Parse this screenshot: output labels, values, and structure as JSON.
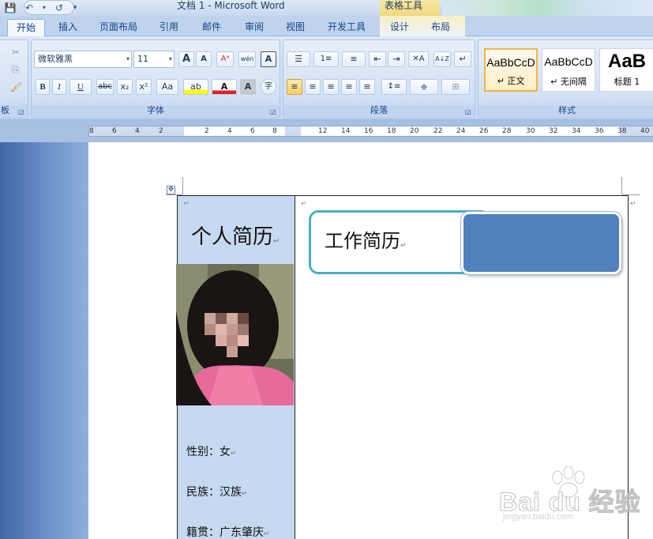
{
  "titlebar": {
    "title": "文档 1 - Microsoft Word",
    "context_tools": "表格工具",
    "qat": {
      "save": "💾",
      "undo": "↶",
      "undo_dd": "▾",
      "redo": "↺",
      "customize": "▾"
    }
  },
  "tabs": [
    {
      "label": "开始",
      "active": true
    },
    {
      "label": "插入"
    },
    {
      "label": "页面布局"
    },
    {
      "label": "引用"
    },
    {
      "label": "邮件"
    },
    {
      "label": "审阅"
    },
    {
      "label": "视图"
    },
    {
      "label": "开发工具"
    },
    {
      "label": "设计",
      "context": true
    },
    {
      "label": "布局",
      "context": true
    }
  ],
  "ribbon": {
    "clipboard": {
      "label": "板",
      "cut": "✂",
      "copy": "⎘",
      "painter": "🖌"
    },
    "font": {
      "label": "字体",
      "name": "微软雅黑",
      "size": "11",
      "grow": "A",
      "shrink": "A",
      "clear": "Aᵃ",
      "phonetic": "wén",
      "border": "A",
      "bold": "B",
      "italic": "I",
      "underline": "U",
      "strike": "abc",
      "sub": "x₂",
      "sup": "x²",
      "case": "Aa",
      "highlight": "ab",
      "color": "A",
      "shade": "A",
      "enclose": "字"
    },
    "paragraph": {
      "label": "段落",
      "bullets": "☰",
      "numbering": "1≡",
      "multilevel": "≡",
      "dec_indent": "⇤",
      "inc_indent": "⇥",
      "chinese_layout": "✕A",
      "sort": "A↓Z",
      "show_marks": "↵",
      "align_left": "≡",
      "center": "≡",
      "align_right": "≡",
      "justify": "≡",
      "distribute": "≡",
      "line_spacing": "↕≡",
      "shading": "◆",
      "borders": "⊞"
    },
    "styles": {
      "label": "样式",
      "items": [
        {
          "sample": "AaBbCcD",
          "name": "↵ 正文",
          "selected": true
        },
        {
          "sample": "AaBbCcD",
          "name": "↵ 无间隔"
        },
        {
          "sample": "AaB",
          "name": "标题 1"
        }
      ]
    }
  },
  "ruler": {
    "labels": [
      "8",
      "6",
      "4",
      "2",
      "2",
      "4",
      "6",
      "8",
      "12",
      "14",
      "16",
      "18",
      "20",
      "22",
      "24",
      "26",
      "28",
      "30",
      "32",
      "34",
      "36",
      "38",
      "40"
    ]
  },
  "document": {
    "resume_title": "个人简历",
    "work_title": "工作简历",
    "para_mark": "↵",
    "info": [
      {
        "label": "性别：女"
      },
      {
        "label": "民族：汉族"
      },
      {
        "label": "籍贯：广东肇庆"
      }
    ]
  },
  "watermark": {
    "text": "Bai du 经验",
    "sub": "jingyan.baidu.com"
  },
  "colors": {
    "left_cell": "#c6d9f1",
    "work_border": "#4bacc6",
    "blue_box": "#4f81bd"
  }
}
